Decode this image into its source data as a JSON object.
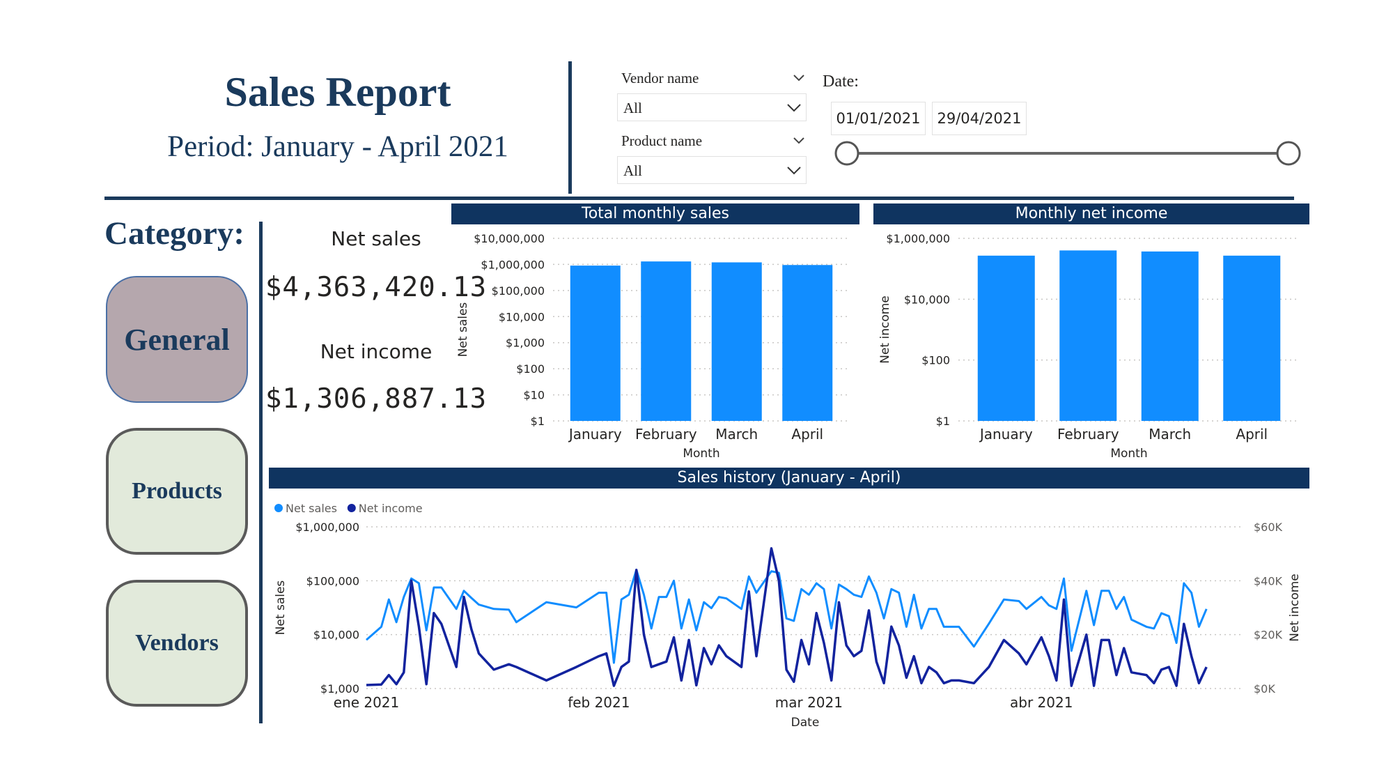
{
  "header": {
    "title": "Sales Report",
    "period": "Period: January - April 2021"
  },
  "filters": {
    "vendor_label": "Vendor name",
    "vendor_value": "All",
    "product_label": "Product name",
    "product_value": "All",
    "date_label": "Date:",
    "date_start": "01/01/2021",
    "date_end": "29/04/2021"
  },
  "category": {
    "label": "Category:",
    "buttons": [
      "General",
      "Products",
      "Vendors"
    ]
  },
  "colors": {
    "navy": "#1a3a5c",
    "bar_blue": "#118dff",
    "dark_line": "#12239e",
    "general_bg": "#b5a7ad",
    "nav_bg": "#e2eadb"
  },
  "kpis": {
    "net_sales_label": "Net sales",
    "net_sales_value": "$4,363,420.13",
    "net_income_label": "Net income",
    "net_income_value": "$1,306,887.13"
  },
  "chart_data": [
    {
      "type": "bar",
      "title": "Total monthly sales",
      "xlabel": "Month",
      "ylabel": "Net sales",
      "scale": "log",
      "ylim": [
        1,
        10000000
      ],
      "yticks": [
        "$1",
        "$10",
        "$100",
        "$1,000",
        "$10,000",
        "$100,000",
        "$1,000,000",
        "$10,000,000"
      ],
      "categories": [
        "January",
        "February",
        "March",
        "April"
      ],
      "values": [
        900000,
        1300000,
        1200000,
        950000
      ]
    },
    {
      "type": "bar",
      "title": "Monthly net income",
      "xlabel": "Month",
      "ylabel": "Net income",
      "scale": "log",
      "ylim": [
        1,
        1000000
      ],
      "yticks": [
        "$1",
        "$100",
        "$10,000",
        "$1,000,000"
      ],
      "categories": [
        "January",
        "February",
        "March",
        "April"
      ],
      "values": [
        270000,
        400000,
        370000,
        270000
      ]
    },
    {
      "type": "line",
      "title": "Sales history (January - April)",
      "xlabel": "Date",
      "ylabel": "Net sales",
      "y2label": "Net income",
      "legend": "top-left",
      "x_ticks": [
        {
          "label": "ene 2021",
          "date": "2021-01-01"
        },
        {
          "label": "feb 2021",
          "date": "2021-02-01"
        },
        {
          "label": "mar 2021",
          "date": "2021-03-01"
        },
        {
          "label": "abr 2021",
          "date": "2021-04-01"
        }
      ],
      "y_ticks": [
        "$1,000",
        "$10,000",
        "$100,000",
        "$1,000,000"
      ],
      "y2_ticks": [
        "$0K",
        "$20K",
        "$40K",
        "$60K"
      ],
      "ylim": [
        1000,
        1000000
      ],
      "y2lim": [
        0,
        60000
      ],
      "x": [
        "2021-01-01",
        "2021-01-03",
        "2021-01-04",
        "2021-01-05",
        "2021-01-06",
        "2021-01-07",
        "2021-01-08",
        "2021-01-09",
        "2021-01-10",
        "2021-01-11",
        "2021-01-13",
        "2021-01-14",
        "2021-01-15",
        "2021-01-16",
        "2021-01-18",
        "2021-01-20",
        "2021-01-21",
        "2021-01-25",
        "2021-01-29",
        "2021-02-01",
        "2021-02-02",
        "2021-02-03",
        "2021-02-04",
        "2021-02-05",
        "2021-02-06",
        "2021-02-07",
        "2021-02-08",
        "2021-02-09",
        "2021-02-10",
        "2021-02-11",
        "2021-02-12",
        "2021-02-13",
        "2021-02-14",
        "2021-02-15",
        "2021-02-16",
        "2021-02-17",
        "2021-02-18",
        "2021-02-20",
        "2021-02-21",
        "2021-02-22",
        "2021-02-24",
        "2021-02-25",
        "2021-02-26",
        "2021-02-27",
        "2021-02-28",
        "2021-03-01",
        "2021-03-02",
        "2021-03-03",
        "2021-03-04",
        "2021-03-05",
        "2021-03-06",
        "2021-03-07",
        "2021-03-08",
        "2021-03-09",
        "2021-03-10",
        "2021-03-11",
        "2021-03-12",
        "2021-03-13",
        "2021-03-14",
        "2021-03-15",
        "2021-03-16",
        "2021-03-17",
        "2021-03-18",
        "2021-03-19",
        "2021-03-20",
        "2021-03-21",
        "2021-03-23",
        "2021-03-25",
        "2021-03-27",
        "2021-03-29",
        "2021-03-30",
        "2021-04-01",
        "2021-04-02",
        "2021-04-03",
        "2021-04-04",
        "2021-04-05",
        "2021-04-07",
        "2021-04-08",
        "2021-04-09",
        "2021-04-10",
        "2021-04-11",
        "2021-04-12",
        "2021-04-13",
        "2021-04-15",
        "2021-04-16",
        "2021-04-17",
        "2021-04-18",
        "2021-04-19",
        "2021-04-20",
        "2021-04-21",
        "2021-04-22",
        "2021-04-23",
        "2021-04-24",
        "2021-04-26",
        "2021-04-27",
        "2021-04-28"
      ],
      "series": [
        {
          "name": "Net sales",
          "values": [
            8000,
            14000,
            45000,
            17000,
            50000,
            110000,
            90000,
            12000,
            75000,
            75000,
            30000,
            65000,
            48000,
            36000,
            30000,
            29000,
            17000,
            40000,
            32000,
            60000,
            60000,
            3000,
            45000,
            55000,
            160000,
            55000,
            13000,
            50000,
            50000,
            100000,
            13000,
            45000,
            12000,
            40000,
            31000,
            50000,
            47000,
            30000,
            120000,
            60000,
            150000,
            140000,
            20000,
            18000,
            70000,
            55000,
            90000,
            70000,
            13000,
            85000,
            70000,
            55000,
            50000,
            120000,
            60000,
            20000,
            70000,
            60000,
            14000,
            55000,
            13000,
            30000,
            30000,
            14000,
            14000,
            14000,
            6000,
            16000,
            45000,
            42000,
            30000,
            50000,
            35000,
            30000,
            110000,
            5000,
            65000,
            15000,
            65000,
            65000,
            30000,
            50000,
            19000,
            14000,
            13000,
            25000,
            22000,
            7000,
            90000,
            60000,
            14000,
            30000
          ]
        },
        {
          "name": "Net income",
          "values": [
            1300,
            1500,
            5000,
            1600,
            6000,
            40000,
            23000,
            1600,
            28000,
            24000,
            8000,
            34000,
            22000,
            13000,
            7000,
            9000,
            8000,
            3000,
            8000,
            12000,
            13000,
            1000,
            8000,
            10000,
            44000,
            20000,
            8000,
            9000,
            10000,
            19000,
            3000,
            18000,
            1200,
            15000,
            9000,
            16000,
            12000,
            8000,
            36000,
            12000,
            52000,
            40000,
            7000,
            2500,
            18000,
            9000,
            28000,
            17000,
            3000,
            32000,
            16000,
            12000,
            14000,
            29000,
            10000,
            2000,
            23000,
            16000,
            4000,
            12000,
            2000,
            8000,
            6000,
            2000,
            3000,
            3000,
            2000,
            8000,
            18000,
            13000,
            9000,
            19000,
            12000,
            3000,
            33000,
            1000,
            20000,
            1000,
            18000,
            18000,
            5000,
            15000,
            6000,
            5000,
            2000,
            7000,
            8000,
            1000,
            24000,
            12000,
            2000,
            8000
          ]
        }
      ]
    }
  ]
}
